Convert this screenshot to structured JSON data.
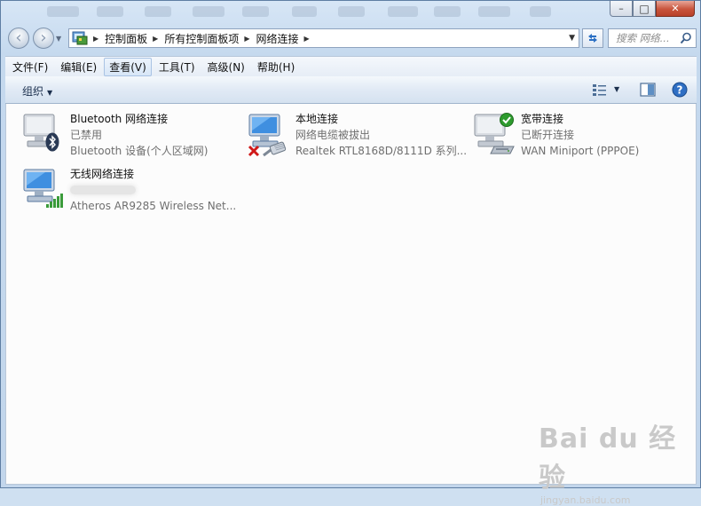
{
  "window": {
    "controls": {
      "minimize": "–",
      "maximize": "□",
      "close": "✕"
    }
  },
  "nav": {
    "back_label": "‹",
    "forward_label": "›",
    "breadcrumbs": [
      "控制面板",
      "所有控制面板项",
      "网络连接"
    ],
    "search_placeholder": "搜索 网络..."
  },
  "menu": {
    "items": [
      "文件(F)",
      "编辑(E)",
      "查看(V)",
      "工具(T)",
      "高级(N)",
      "帮助(H)"
    ]
  },
  "toolbar": {
    "organize_label": "组织"
  },
  "connections": [
    {
      "name": "Bluetooth 网络连接",
      "status": "已禁用",
      "device": "Bluetooth 设备(个人区域网)",
      "badge": "bluetooth-icon"
    },
    {
      "name": "本地连接",
      "status": "网络电缆被拔出",
      "device": "Realtek RTL8168D/8111D 系列...",
      "badge": "red-x-icon"
    },
    {
      "name": "宽带连接",
      "status": "已断开连接",
      "device": "WAN Miniport (PPPOE)",
      "badge": "green-check-icon"
    },
    {
      "name": "无线网络连接",
      "status": "",
      "device": "Atheros AR9285 Wireless Net...",
      "badge": "wifi-signal-icon"
    }
  ],
  "watermark": {
    "main": "Bai du 经验",
    "sub": "jingyan.baidu.com"
  },
  "colors": {
    "accent": "#2a5fa6",
    "close_button": "#c8543c",
    "check_green": "#2e9b2e",
    "error_red": "#d01818"
  }
}
